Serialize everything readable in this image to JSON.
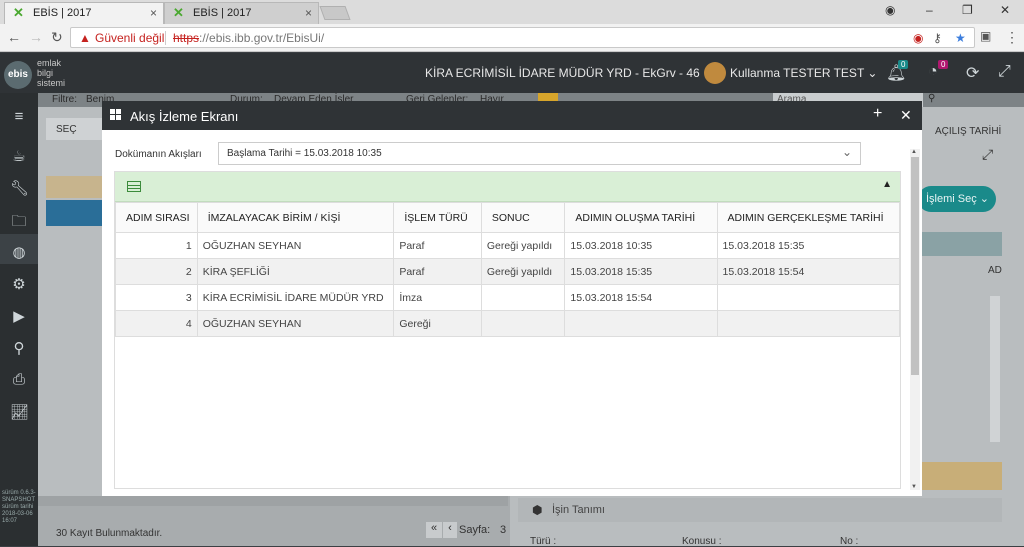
{
  "browser": {
    "tabs": [
      {
        "label": "EBİS | 2017",
        "close": "×"
      },
      {
        "label": "EBİS | 2017",
        "close": "×"
      }
    ],
    "security_label": "Güvenli değil",
    "url_protocol": "https",
    "url_rest": "://ebis.ibb.gov.tr/EbisUi/"
  },
  "app_header": {
    "logo_short": "ebis",
    "logo_lines": [
      "emlak",
      "bilgi",
      "sistemi"
    ],
    "title": "KİRA ECRİMİSİL İDARE MÜDÜR YRD - EkGrv - 46",
    "user": "Kullanma TESTER TEST",
    "notif_count": "0",
    "task_count": "0"
  },
  "background": {
    "filter_label": "Filtre:",
    "filter_value": "Benim",
    "durum_label": "Durum:",
    "durum_value": "Devam Eden İşler",
    "geri_label": "Geri Gelenler:",
    "geri_value": "Hayır",
    "search_placeholder": "Arama",
    "sec_header": "SEÇ",
    "right_header": "AÇILIŞ TARİHİ",
    "islem_sec_button": "İşlemi Seç",
    "record_count": "30 Kayıt Bulunmaktadır.",
    "page_label": "Sayfa:",
    "page_number": "3",
    "isin_tanimi": "İşin Tanımı",
    "turu_label": "Türü :",
    "konusu_label": "Konusu :",
    "no_label": "No :",
    "ad_label": "AD",
    "version_text": "sürüm 0.6.3-SNAPSHOT sürüm tarihi 2018-03-06 16:07"
  },
  "modal": {
    "title": "Akış İzleme Ekranı",
    "doc_label": "Dokümanın Akışları",
    "doc_select_value": "Başlama Tarihi = 15.03.2018 10:35",
    "columns": [
      "ADIM SIRASI",
      "İMZALAYACAK BİRİM / KİŞİ",
      "İŞLEM TÜRÜ",
      "SONUC",
      "ADIMIN OLUŞMA TARİHİ",
      "ADIMIN GERÇEKLEŞME TARİHİ"
    ],
    "rows": [
      {
        "sira": "1",
        "kisi": "OĞUZHAN SEYHAN",
        "tur": "Paraf",
        "sonuc": "Gereği yapıldı",
        "olusma": "15.03.2018 10:35",
        "gerceklesme": "15.03.2018 15:35"
      },
      {
        "sira": "2",
        "kisi": "KİRA ŞEFLİĞİ",
        "tur": "Paraf",
        "sonuc": "Gereği yapıldı",
        "olusma": "15.03.2018 15:35",
        "gerceklesme": "15.03.2018 15:54"
      },
      {
        "sira": "3",
        "kisi": "KİRA ECRİMİSİL İDARE MÜDÜR YRD",
        "tur": "İmza",
        "sonuc": "",
        "olusma": "15.03.2018 15:54",
        "gerceklesme": ""
      },
      {
        "sira": "4",
        "kisi": "OĞUZHAN SEYHAN",
        "tur": "Gereği",
        "sonuc": "",
        "olusma": "",
        "gerceklesme": ""
      }
    ]
  },
  "icons": {
    "window": "windows-icon",
    "add": "plus-icon",
    "close": "close-icon",
    "table": "table-icon",
    "collapse": "caret-up-icon",
    "chevron": "chevron-down-icon"
  },
  "colors": {
    "header_dark": "#2f3336",
    "grid_toolbar": "#d9efd6",
    "teal_button": "#1a8a8a",
    "warning_red": "#c5221f"
  }
}
